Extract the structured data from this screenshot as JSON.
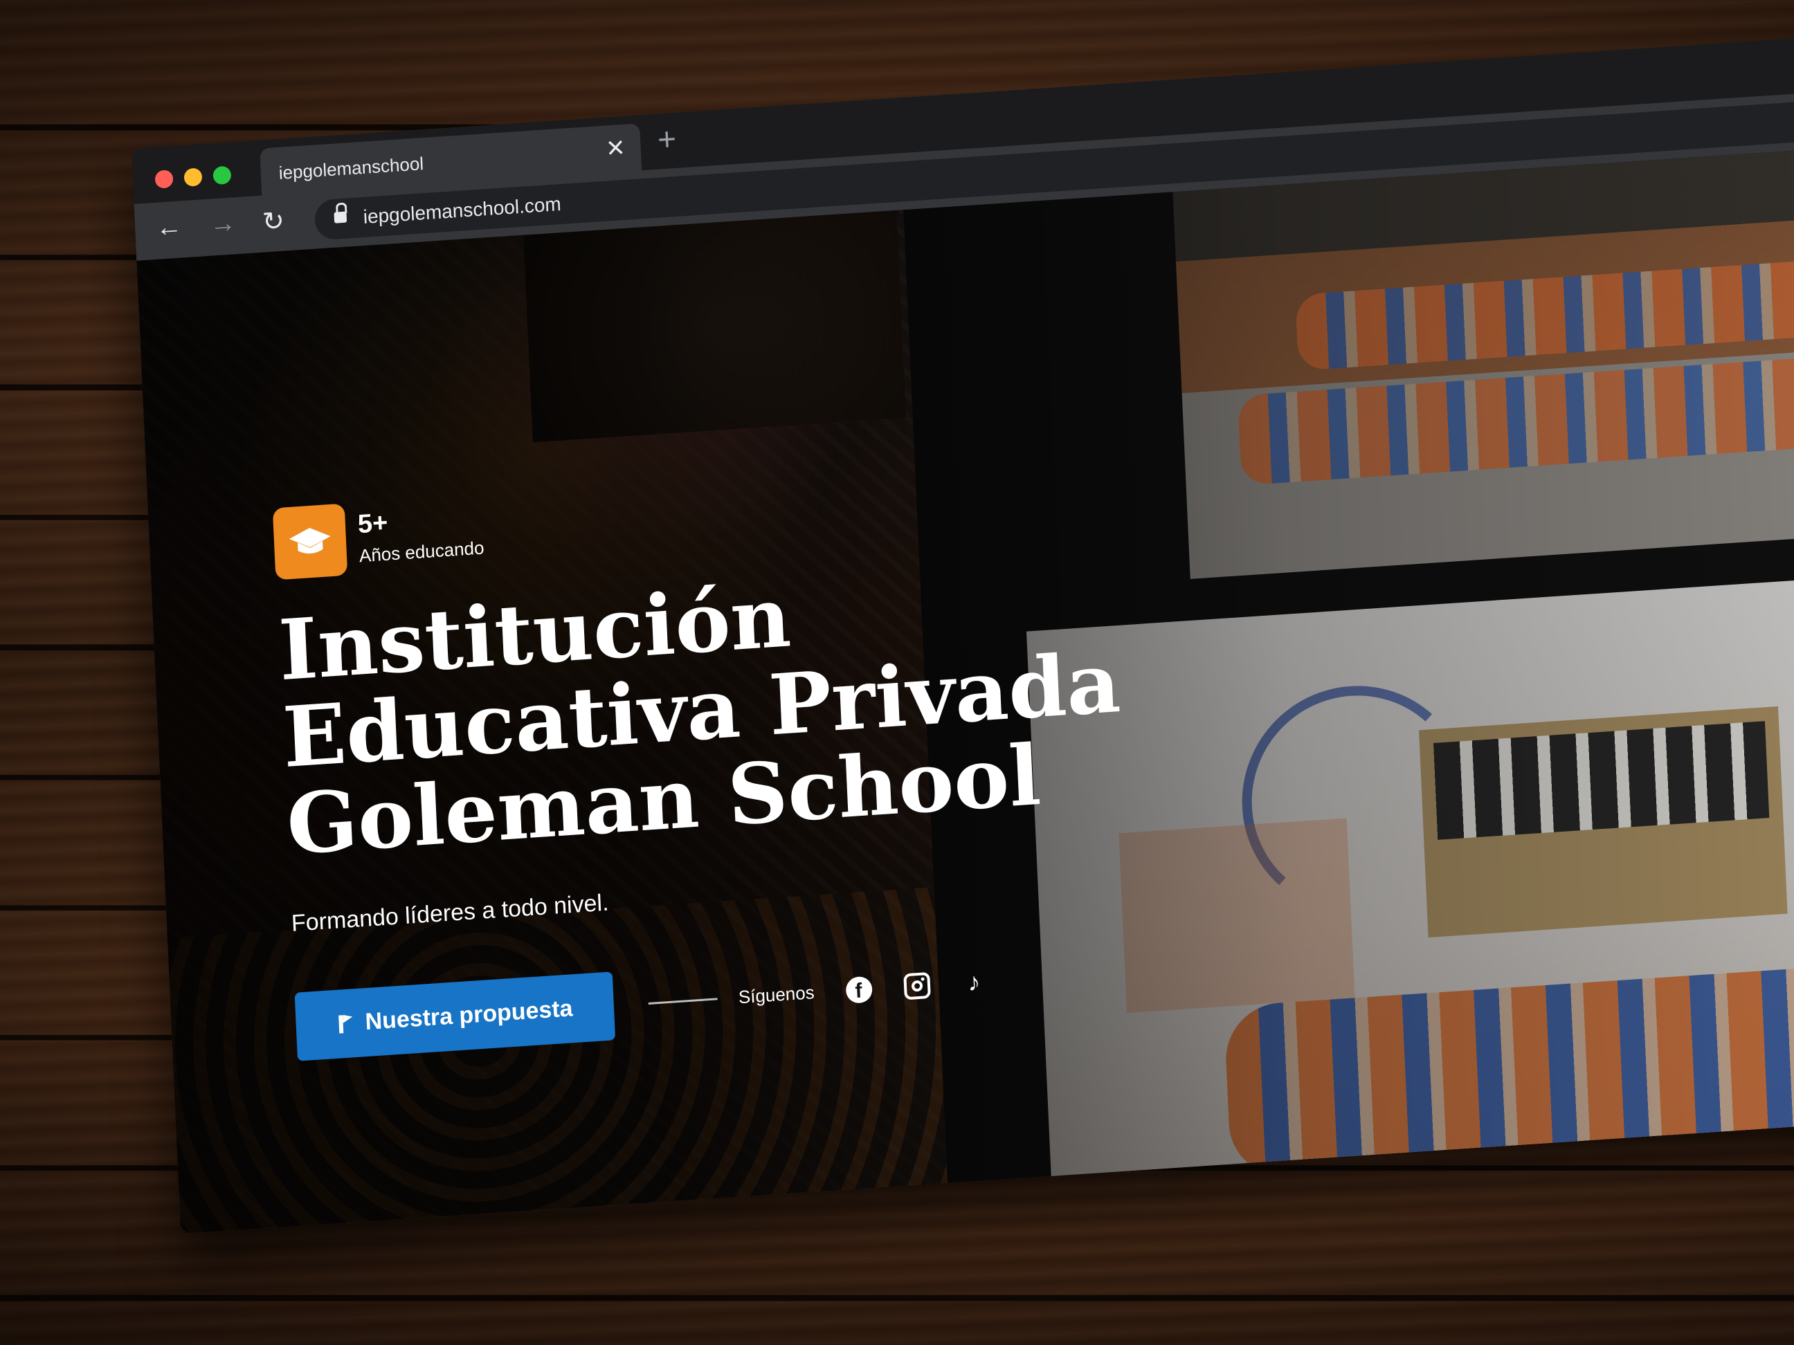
{
  "browser": {
    "tab_title": "iepgolemanschool",
    "url": "iepgolemanschool.com",
    "new_tab_icon": "plus-icon",
    "close_tab_icon": "close-icon"
  },
  "hero": {
    "badge": {
      "number": "5+",
      "label": "Años educando",
      "icon": "graduation-cap-icon"
    },
    "title_lines": [
      "Institución",
      "Educativa Privada",
      "Goleman School"
    ],
    "subtitle": "Formando líderes a todo nivel.",
    "cta_label": "Nuestra propuesta",
    "follow_label": "Síguenos",
    "social_icons": [
      "facebook-icon",
      "instagram-icon",
      "tiktok-icon"
    ]
  },
  "colors": {
    "accent_orange": "#ef8a1f",
    "cta_blue": "#1774c6",
    "browser_chrome": "#35363a"
  }
}
